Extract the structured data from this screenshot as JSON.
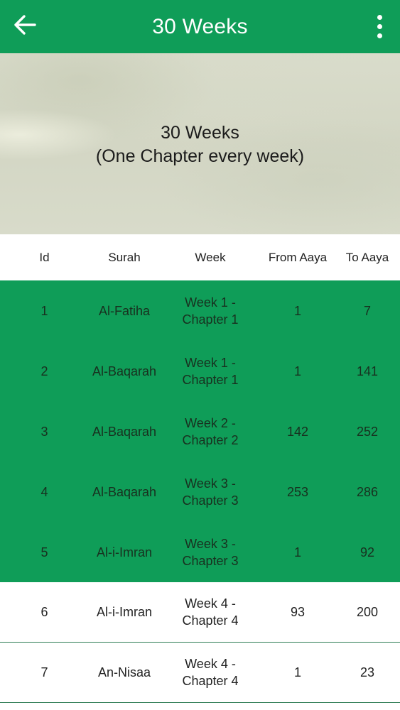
{
  "appbar": {
    "title": "30 Weeks",
    "back_icon": "arrow-left-icon",
    "overflow_icon": "more-vert-icon"
  },
  "banner": {
    "line1": "30 Weeks",
    "line2": "(One Chapter every week)"
  },
  "table": {
    "headers": {
      "id": "Id",
      "surah": "Surah",
      "week": "Week",
      "from": "From Aaya",
      "to": "To Aaya"
    },
    "rows": [
      {
        "id": "1",
        "surah": "Al-Fatiha",
        "week": "Week 1 - Chapter 1",
        "from": "1",
        "to": "7",
        "highlighted": true
      },
      {
        "id": "2",
        "surah": "Al-Baqarah",
        "week": "Week 1 - Chapter 1",
        "from": "1",
        "to": "141",
        "highlighted": true
      },
      {
        "id": "3",
        "surah": "Al-Baqarah",
        "week": "Week 2 - Chapter 2",
        "from": "142",
        "to": "252",
        "highlighted": true
      },
      {
        "id": "4",
        "surah": "Al-Baqarah",
        "week": "Week 3 - Chapter 3",
        "from": "253",
        "to": "286",
        "highlighted": true
      },
      {
        "id": "5",
        "surah": "Al-i-Imran",
        "week": "Week 3 - Chapter 3",
        "from": "1",
        "to": "92",
        "highlighted": true
      },
      {
        "id": "6",
        "surah": "Al-i-Imran",
        "week": "Week 4 - Chapter 4",
        "from": "93",
        "to": "200",
        "highlighted": false
      },
      {
        "id": "7",
        "surah": "An-Nisaa",
        "week": "Week 4 - Chapter 4",
        "from": "1",
        "to": "23",
        "highlighted": false
      }
    ]
  },
  "colors": {
    "primary": "#0f9d58",
    "divider": "#2f7d55"
  }
}
